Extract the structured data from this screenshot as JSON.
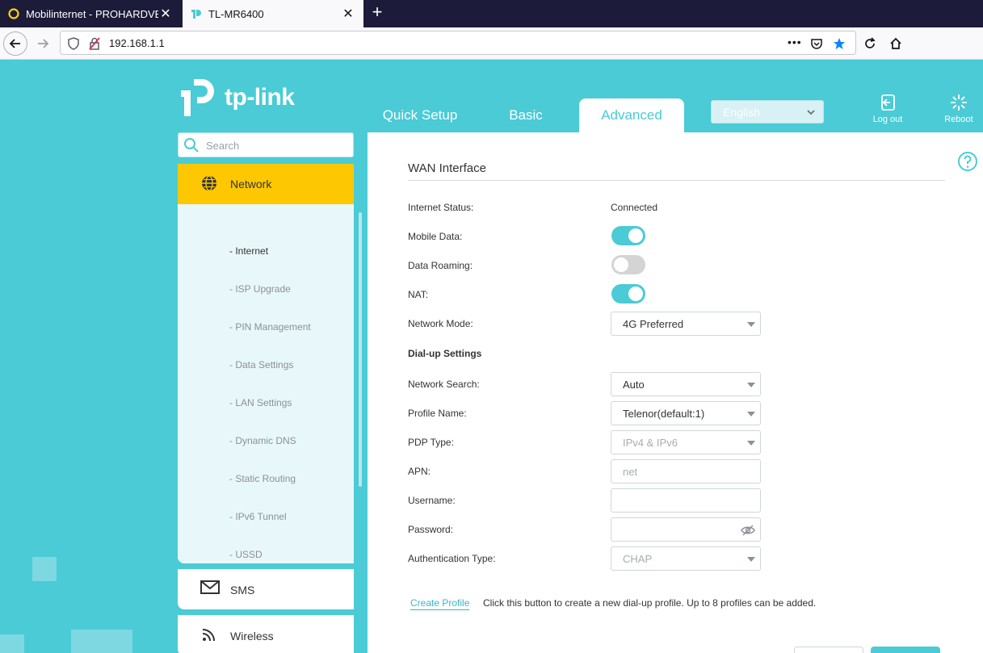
{
  "browser": {
    "tabs": [
      {
        "title": "Mobilinternet - PROHARDVER!",
        "active": false
      },
      {
        "title": "TL-MR6400",
        "active": true
      }
    ],
    "new_tab": "+",
    "url": "192.168.1.1"
  },
  "router": {
    "brand": "tp-link",
    "main_tabs": [
      "Quick Setup",
      "Basic",
      "Advanced"
    ],
    "active_tab": "Advanced",
    "language": "English",
    "logout_label": "Log out",
    "reboot_label": "Reboot",
    "search_placeholder": "Search"
  },
  "sidebar": {
    "active_group": "Network",
    "subitems": [
      "- Internet",
      "- ISP Upgrade",
      "- PIN Management",
      "- Data Settings",
      "- LAN Settings",
      "- Dynamic DNS",
      "- Static Routing",
      "- IPv6 Tunnel",
      "- USSD"
    ],
    "active_subitem": "- Internet",
    "groups": [
      "SMS",
      "Wireless"
    ]
  },
  "wan": {
    "title": "WAN Interface",
    "internet_status_label": "Internet Status:",
    "internet_status_value": "Connected",
    "mobile_data_label": "Mobile Data:",
    "mobile_data_on": true,
    "data_roaming_label": "Data Roaming:",
    "data_roaming_on": false,
    "nat_label": "NAT:",
    "nat_on": true,
    "network_mode_label": "Network Mode:",
    "network_mode_value": "4G Preferred",
    "dialup_heading": "Dial-up Settings",
    "network_search_label": "Network Search:",
    "network_search_value": "Auto",
    "profile_name_label": "Profile Name:",
    "profile_name_value": "Telenor(default:1)",
    "pdp_type_label": "PDP Type:",
    "pdp_type_value": "IPv4 & IPv6",
    "apn_label": "APN:",
    "apn_value": "net",
    "username_label": "Username:",
    "username_value": "",
    "password_label": "Password:",
    "password_value": "",
    "auth_type_label": "Authentication Type:",
    "auth_type_value": "CHAP",
    "create_profile_label": "Create Profile",
    "create_profile_note": "Click this button to create a new dial-up profile. Up to 8 profiles can be added."
  },
  "colors": {
    "brand_teal": "#4acbd6",
    "active_yellow": "#fdc702",
    "tab_bar": "#1c1b3a"
  }
}
